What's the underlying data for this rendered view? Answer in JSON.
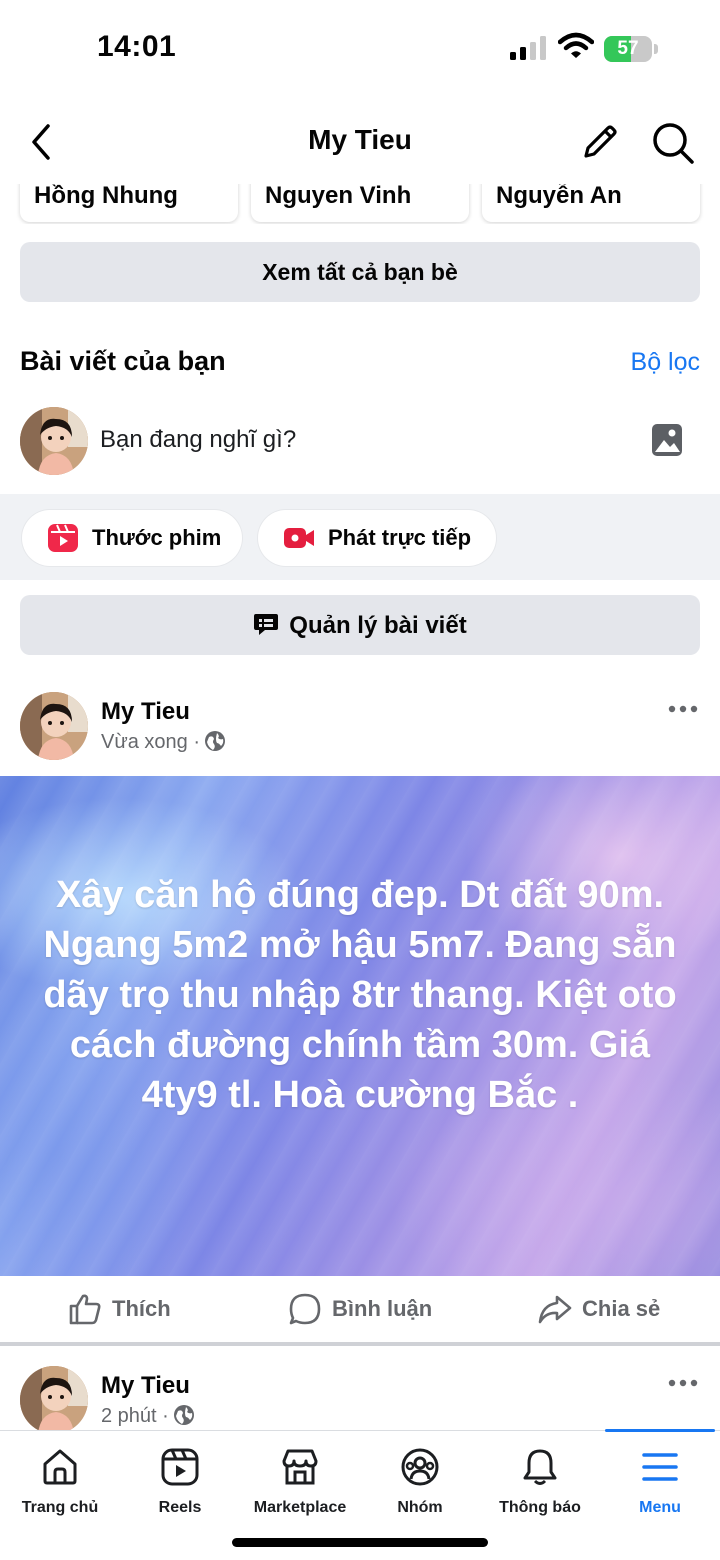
{
  "status_bar": {
    "time": "14:01",
    "battery": "57",
    "battery_level": 0.57
  },
  "header": {
    "title": "My Tieu"
  },
  "friends": {
    "names": [
      "Hồng Nhung",
      "Nguyen Vinh",
      "Nguyễn An"
    ],
    "see_all": "Xem tất cả bạn bè"
  },
  "posts_section": {
    "title": "Bài viết của bạn",
    "filter": "Bộ lọc"
  },
  "composer": {
    "placeholder": "Bạn đang nghĩ gì?"
  },
  "chips": {
    "reel": "Thước phim",
    "live": "Phát trực tiếp"
  },
  "manage_posts": "Quản lý bài viết",
  "post1": {
    "author": "My Tieu",
    "time": "Vừa xong ·",
    "text": "Xây căn hộ đúng đep. Dt đất 90m. Ngang 5m2 mở hậu 5m7. Đang sẵn dãy trọ thu nhập 8tr thang. Kiệt oto cách đường chính tầm 30m. Giá 4ty9 tl. Hoà cường Bắc .",
    "actions": {
      "like": "Thích",
      "comment": "Bình luận",
      "share": "Chia sẻ"
    }
  },
  "post2": {
    "author": "My Tieu",
    "time": "2 phút ·"
  },
  "tabs": [
    {
      "label": "Trang chủ",
      "icon": "home-icon"
    },
    {
      "label": "Reels",
      "icon": "reels-icon"
    },
    {
      "label": "Marketplace",
      "icon": "marketplace-icon"
    },
    {
      "label": "Nhóm",
      "icon": "groups-icon"
    },
    {
      "label": "Thông báo",
      "icon": "bell-icon"
    },
    {
      "label": "Menu",
      "icon": "menu-icon",
      "active": true
    }
  ],
  "colors": {
    "accent": "#1877f2",
    "reel_red": "#f0284a",
    "live_red": "#e41e3f",
    "battery_green": "#34c759"
  }
}
